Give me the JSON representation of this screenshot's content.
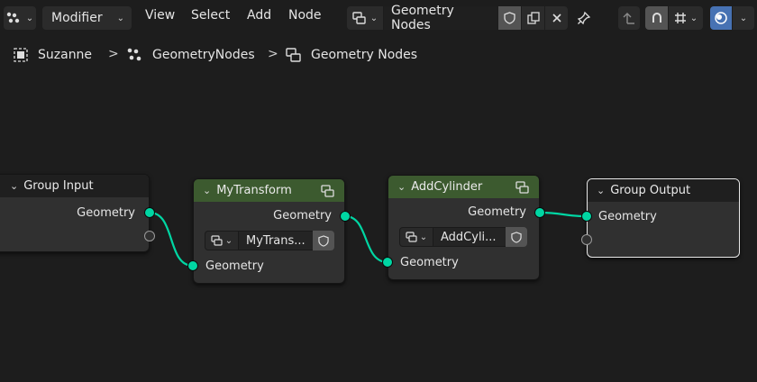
{
  "header": {
    "editor_type_icon": "node-editor-icon",
    "mode_select": "Modifier",
    "menus": [
      "View",
      "Select",
      "Add",
      "Node"
    ],
    "node_tree_icon": "node-tree-icon",
    "node_tree_name": "Geometry Nodes",
    "fake_user_icon": "shield-icon",
    "duplicate_icon": "duplicate-icon",
    "unlink_icon": "close-icon",
    "pin_icon": "pin-icon",
    "parent_icon": "arrow-up-icon",
    "snap_icon": "magnet-icon",
    "overlay_icon": "overlay-icon"
  },
  "breadcrumb": {
    "items": [
      "Suzanne",
      "GeometryNodes",
      "Geometry Nodes"
    ],
    "separator": ">"
  },
  "nodes": {
    "group_input": {
      "title": "Group Input",
      "outputs": [
        "Geometry"
      ]
    },
    "my_transform": {
      "title": "MyTransform",
      "output": "Geometry",
      "group_name": "MyTrans...",
      "input": "Geometry"
    },
    "add_cylinder": {
      "title": "AddCylinder",
      "output": "Geometry",
      "group_name": "AddCyli...",
      "input": "Geometry"
    },
    "group_output": {
      "title": "Group Output",
      "inputs": [
        "Geometry"
      ]
    }
  },
  "colors": {
    "background": "#1d1d1d",
    "geometry_socket": "#00d6a3",
    "group_node_header": "#3c5a2f",
    "active_blue": "#4772b3"
  }
}
